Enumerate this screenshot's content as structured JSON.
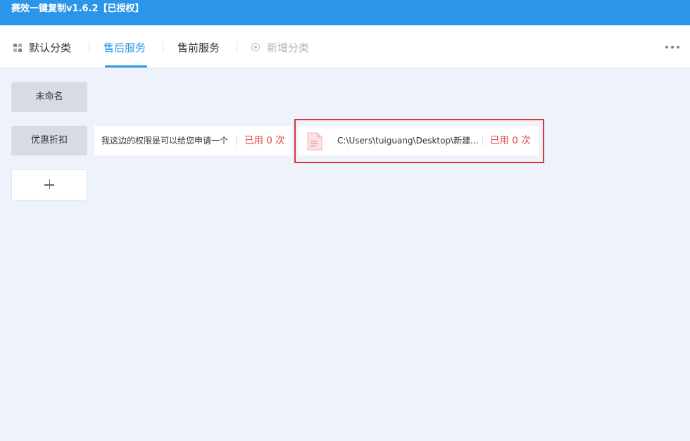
{
  "window": {
    "title": "赛效一键复制v1.6.2【已授权】"
  },
  "tabs": [
    {
      "label": "默认分类",
      "icon": "grid-icon"
    },
    {
      "label": "售后服务",
      "active": true
    },
    {
      "label": "售前服务"
    },
    {
      "label": "新增分类",
      "icon": "add-circle-icon"
    }
  ],
  "categories": [
    {
      "label": "未命名"
    },
    {
      "label": "优惠折扣"
    }
  ],
  "items": [
    {
      "text": "我这边的权限是可以给您申请一个",
      "usage": "已用 0 次"
    },
    {
      "text": "C:\\Users\\tuiguang\\Desktop\\新建...",
      "usage": "已用 0 次",
      "icon": "file-icon"
    }
  ],
  "colors": {
    "accent": "#2b96e9",
    "usage": "#e04545",
    "highlight": "#e03333"
  }
}
